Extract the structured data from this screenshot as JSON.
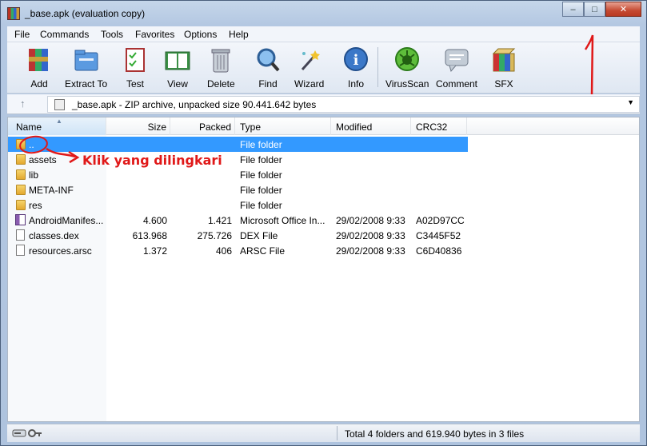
{
  "window": {
    "title": "_base.apk (evaluation copy)",
    "controls": {
      "minimize": "–",
      "maximize": "□",
      "close": "✕"
    }
  },
  "menu": [
    "File",
    "Commands",
    "Tools",
    "Favorites",
    "Options",
    "Help"
  ],
  "toolbar": {
    "tools": [
      {
        "label": "Add",
        "icon": "archive-add-icon"
      },
      {
        "label": "Extract To",
        "icon": "extract-folder-icon"
      },
      {
        "label": "Test",
        "icon": "test-checklist-icon"
      },
      {
        "label": "View",
        "icon": "view-book-icon"
      },
      {
        "label": "Delete",
        "icon": "trash-icon"
      },
      {
        "label": "Find",
        "icon": "magnifier-icon"
      },
      {
        "label": "Wizard",
        "icon": "wand-icon"
      },
      {
        "label": "Info",
        "icon": "info-icon"
      },
      {
        "label": "VirusScan",
        "icon": "virus-scan-icon"
      },
      {
        "label": "Comment",
        "icon": "comment-icon"
      },
      {
        "label": "SFX",
        "icon": "sfx-box-icon"
      }
    ]
  },
  "address": {
    "up_icon": "↑",
    "path": "_base.apk - ZIP archive, unpacked size 90.441.642 bytes",
    "dropdown_icon": "▼"
  },
  "columns": [
    "Name",
    "Size",
    "Packed",
    "Type",
    "Modified",
    "CRC32"
  ],
  "files": [
    {
      "name": "..",
      "size": "",
      "packed": "",
      "type": "File folder",
      "modified": "",
      "crc": "",
      "icon": "folder",
      "selected": true
    },
    {
      "name": "assets",
      "size": "",
      "packed": "",
      "type": "File folder",
      "modified": "",
      "crc": "",
      "icon": "folder"
    },
    {
      "name": "lib",
      "size": "",
      "packed": "",
      "type": "File folder",
      "modified": "",
      "crc": "",
      "icon": "folder"
    },
    {
      "name": "META-INF",
      "size": "",
      "packed": "",
      "type": "File folder",
      "modified": "",
      "crc": "",
      "icon": "folder"
    },
    {
      "name": "res",
      "size": "",
      "packed": "",
      "type": "File folder",
      "modified": "",
      "crc": "",
      "icon": "folder"
    },
    {
      "name": "AndroidManifes...",
      "size": "4.600",
      "packed": "1.421",
      "type": "Microsoft Office In...",
      "modified": "29/02/2008 9:33",
      "crc": "A02D97CC",
      "icon": "doc"
    },
    {
      "name": "classes.dex",
      "size": "613.968",
      "packed": "275.726",
      "type": "DEX File",
      "modified": "29/02/2008 9:33",
      "crc": "C3445F52",
      "icon": "file"
    },
    {
      "name": "resources.arsc",
      "size": "1.372",
      "packed": "406",
      "type": "ARSC File",
      "modified": "29/02/2008 9:33",
      "crc": "C6D40836",
      "icon": "file"
    }
  ],
  "status": {
    "text": "Total 4 folders and 619.940 bytes in 3 files"
  },
  "annotation": {
    "text": "Klik yang dilingkari",
    "color": "#e01818"
  },
  "colors": {
    "selection": "#3399ff",
    "annotation": "#e01818"
  }
}
